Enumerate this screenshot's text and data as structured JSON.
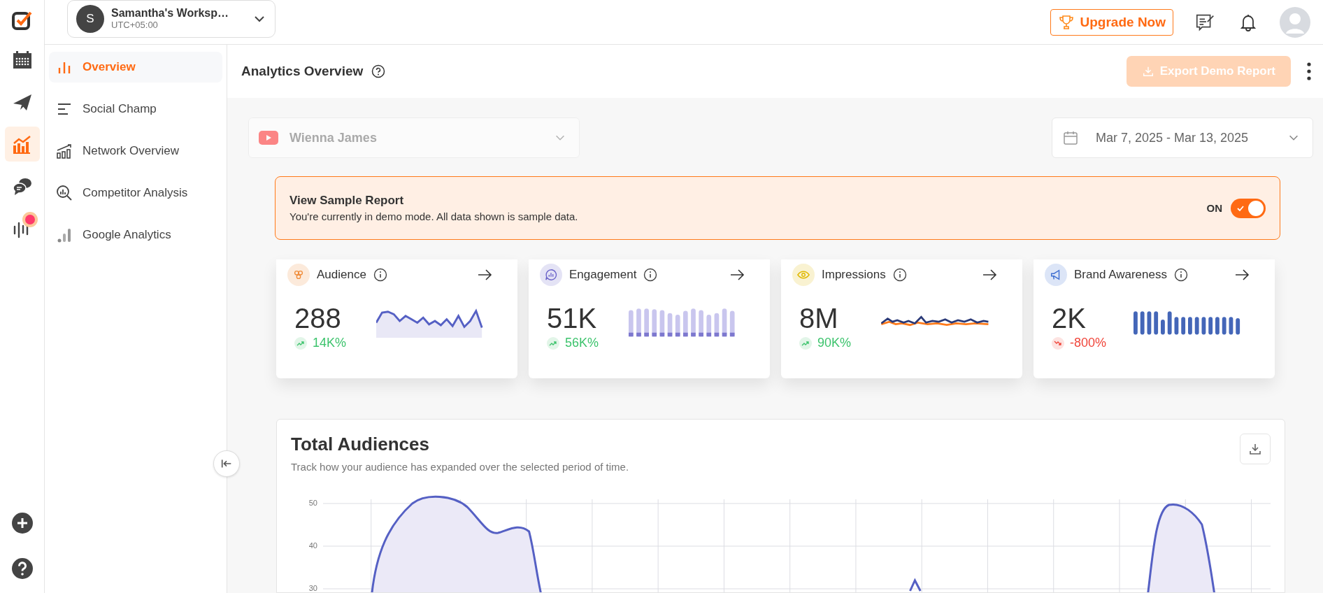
{
  "rail": {
    "items": [
      {
        "selected": false,
        "badge": false
      },
      {
        "selected": false,
        "badge": false
      },
      {
        "selected": true,
        "badge": false
      },
      {
        "selected": false,
        "badge": false
      },
      {
        "selected": false,
        "badge": true
      }
    ]
  },
  "workspace": {
    "initial": "S",
    "name": "Samantha's Worksp…",
    "timezone": "UTC+05:00"
  },
  "topbar": {
    "upgrade_label": "Upgrade Now"
  },
  "sidebar": {
    "items": [
      {
        "label": "Overview",
        "selected": true
      },
      {
        "label": "Social Champ",
        "selected": false
      },
      {
        "label": "Network Overview",
        "selected": false
      },
      {
        "label": "Competitor Analysis",
        "selected": false
      },
      {
        "label": "Google Analytics",
        "selected": false
      }
    ]
  },
  "page": {
    "title": "Analytics Overview",
    "export": {
      "label": "Export Demo Report",
      "disabled": true
    }
  },
  "filters": {
    "account": {
      "value": "Wienna James",
      "disabled": true
    },
    "date_range": {
      "value": "Mar 7, 2025 - Mar 13, 2025"
    }
  },
  "banner": {
    "title": "View Sample Report",
    "text": "You're currently in demo mode. All data shown is sample data.",
    "toggle_label": "ON",
    "on": true
  },
  "cards": [
    {
      "title": "Audience",
      "value": "288",
      "change": "14K%",
      "rising": true,
      "color": "#f08c3a"
    },
    {
      "title": "Engagement",
      "value": "51K",
      "change": "56K%",
      "rising": true,
      "color": "#6b63c9"
    },
    {
      "title": "Impressions",
      "value": "8M",
      "change": "90K%",
      "rising": true,
      "color": "#e0b800"
    },
    {
      "title": "Brand Awareness",
      "value": "2K",
      "change": "-800%",
      "rising": false,
      "color": "#3f6fd1"
    }
  ],
  "chart": {
    "title": "Total Audiences",
    "subtitle": "Track how your audience has expanded over the selected period of time.",
    "y_labels": [
      "50",
      "40",
      "30"
    ]
  }
}
